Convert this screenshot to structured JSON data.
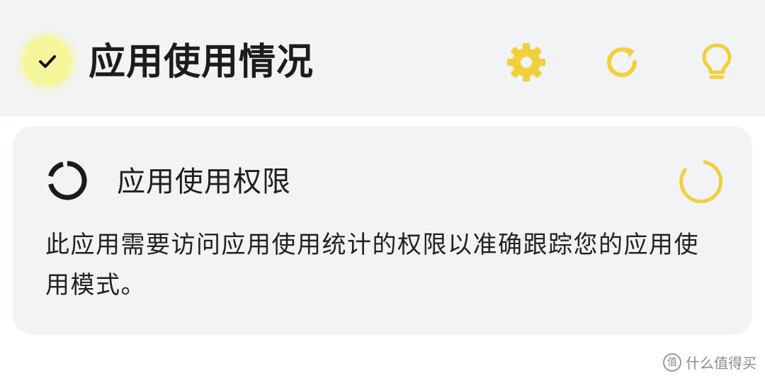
{
  "header": {
    "title": "应用使用情况",
    "badge_icon": "check-icon",
    "actions": [
      {
        "name": "settings",
        "icon": "gear-icon"
      },
      {
        "name": "refresh",
        "icon": "refresh-icon"
      },
      {
        "name": "tip",
        "icon": "lightbulb-icon"
      }
    ]
  },
  "permission_card": {
    "icon": "progress-ring-icon",
    "title": "应用使用权限",
    "status_icon": "loading-spinner-icon",
    "description": "此应用需要访问应用使用统计的权限以准确跟踪您的应用使用模式。"
  },
  "watermark": {
    "badge": "值",
    "text": "什么值得买"
  },
  "colors": {
    "accent": "#f2cf3c",
    "badge_bg": "#f5f59a",
    "panel_bg": "#f2f3f5",
    "text": "#1c1c1c"
  }
}
